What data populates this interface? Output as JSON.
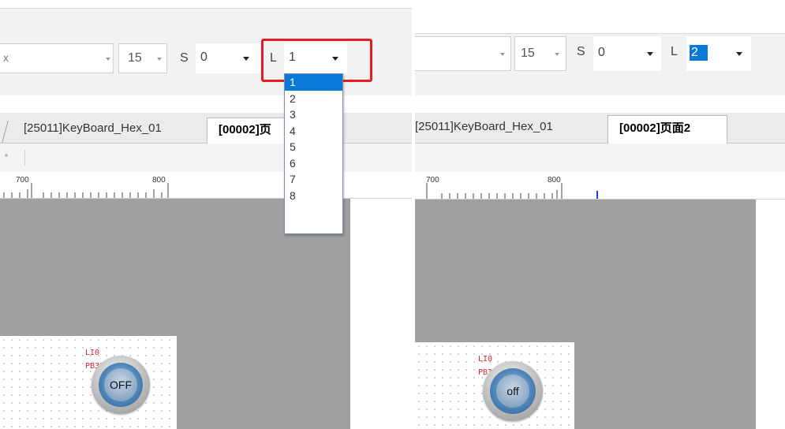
{
  "left": {
    "toolbar": {
      "font_name_partial": "x",
      "font_size": "15",
      "s_label": "S",
      "s_value": "0",
      "l_label": "L",
      "l_value": "1"
    },
    "dropdown": {
      "options": [
        "1",
        "2",
        "3",
        "4",
        "5",
        "6",
        "7",
        "8"
      ],
      "selected_index": 0
    },
    "tabs": [
      {
        "label": "[25011]KeyBoard_Hex_01",
        "active": false
      },
      {
        "label": "[00002]页",
        "active": true
      }
    ],
    "ruler": {
      "label_700": "700",
      "label_800": "800"
    },
    "widget": {
      "label_line1": "LI0",
      "label_line2": "PB30",
      "button_text": "OFF"
    }
  },
  "right": {
    "toolbar": {
      "font_size": "15",
      "s_label": "S",
      "s_value": "0",
      "l_label": "L",
      "l_value": "2"
    },
    "tabs": [
      {
        "label": "[25011]KeyBoard_Hex_01",
        "active": false
      },
      {
        "label": "[00002]页面2",
        "active": true
      }
    ],
    "ruler": {
      "label_700": "700",
      "label_800": "800"
    },
    "widget": {
      "label_line1": "LI0",
      "label_line2": "PB30",
      "button_text": "off"
    }
  },
  "colors": {
    "highlight": "#e51c23",
    "selection": "#0a78d7",
    "canvas_gray": "#a0a0a0",
    "label_red": "#d2293b"
  }
}
